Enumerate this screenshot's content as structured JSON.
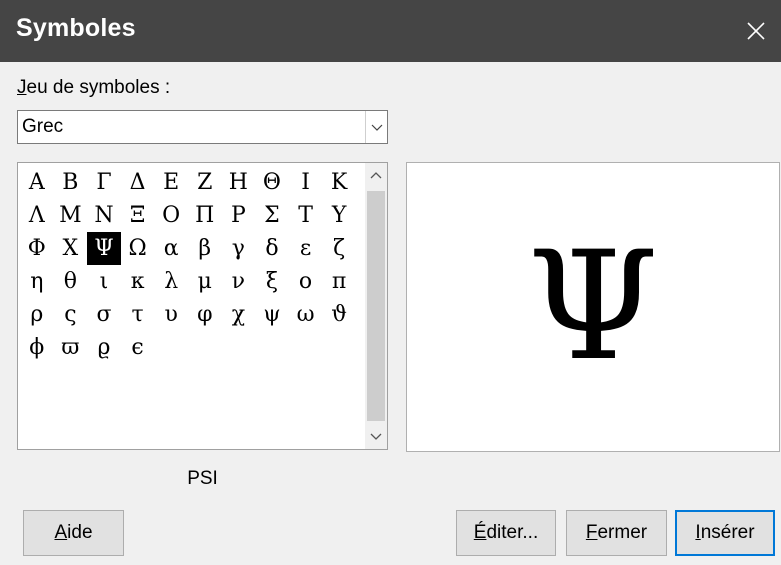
{
  "window": {
    "title": "Symboles",
    "close_icon": "close-icon"
  },
  "symbol_set": {
    "label_mnemonic": "J",
    "label_rest": "eu de symboles :",
    "selected": "Grec",
    "dropdown_icon": "chevron-down-icon"
  },
  "symbols": [
    "Α",
    "Β",
    "Γ",
    "Δ",
    "Ε",
    "Ζ",
    "Η",
    "Θ",
    "Ι",
    "Κ",
    "Λ",
    "Μ",
    "Ν",
    "Ξ",
    "Ο",
    "Π",
    "Ρ",
    "Σ",
    "Τ",
    "Υ",
    "Φ",
    "Χ",
    "Ψ",
    "Ω",
    "α",
    "β",
    "γ",
    "δ",
    "ε",
    "ζ",
    "η",
    "θ",
    "ι",
    "κ",
    "λ",
    "μ",
    "ν",
    "ξ",
    "ο",
    "π",
    "ρ",
    "ς",
    "σ",
    "τ",
    "υ",
    "φ",
    "χ",
    "ψ",
    "ω",
    "ϑ",
    "ϕ",
    "ϖ",
    "ϱ",
    "ϵ"
  ],
  "selected_symbol": "Ψ",
  "selected_name": "PSI",
  "buttons": {
    "help": {
      "mnemonic": "A",
      "rest": "ide"
    },
    "edit": {
      "mnemonic": "É",
      "rest": "diter..."
    },
    "close": {
      "mnemonic": "F",
      "rest": "ermer"
    },
    "insert": {
      "mnemonic": "I",
      "rest": "nsérer"
    }
  },
  "colors": {
    "titlebar": "#454545",
    "dialog_bg": "#f0f0f0",
    "selection": "#000000",
    "default_button_border": "#0078d7"
  }
}
